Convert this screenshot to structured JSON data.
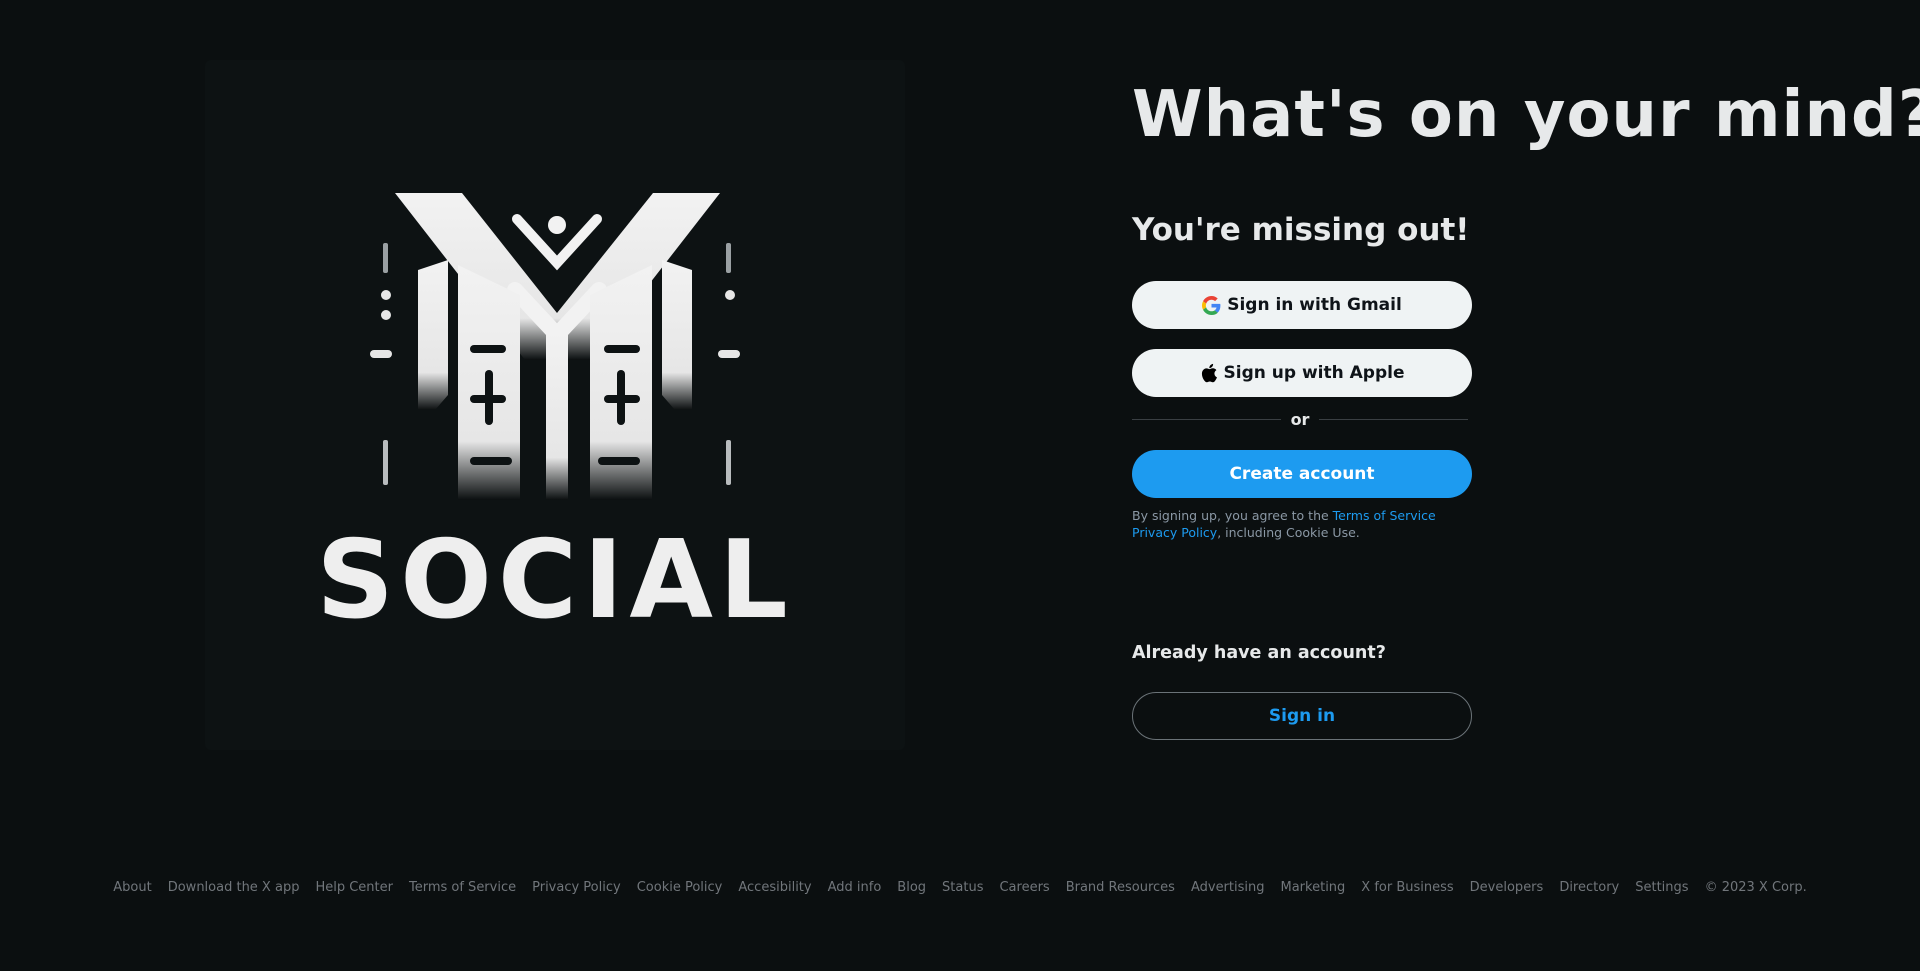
{
  "hero": {
    "headline": "What's on your mind?",
    "logo_text": "SOCIAL"
  },
  "signup": {
    "subhead": "You're missing out!",
    "gmail_label": "Sign in with Gmail",
    "apple_label": "Sign up with Apple",
    "divider_label": "or",
    "create_label": "Create account",
    "terms_prefix": "By signing up, you agree to the ",
    "terms_link": "Terms of Service Privacy Policy",
    "terms_suffix": ", including Cookie Use."
  },
  "login": {
    "prompt": "Already have an account?",
    "signin_label": "Sign in"
  },
  "footer": {
    "links": [
      "About",
      "Download the X app",
      "Help Center",
      "Terms of Service",
      "Privacy Policy",
      "Cookie Policy",
      "Accesibility",
      "Add info",
      "Blog",
      "Status",
      "Careers",
      "Brand Resources",
      "Advertising",
      "Marketing",
      "X for Business",
      "Developers",
      "Directory",
      "Settings"
    ],
    "copyright": "© 2023 X Corp."
  },
  "colors": {
    "background": "#0b0f10",
    "accent": "#1d9bf0",
    "light_button": "#eff3f4",
    "muted_text": "#71767b"
  }
}
